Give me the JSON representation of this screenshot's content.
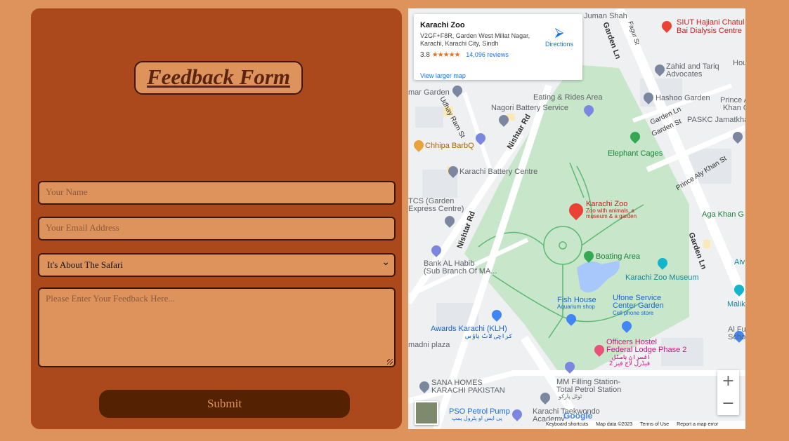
{
  "form": {
    "title": "Feedback Form",
    "name_placeholder": "Your Name",
    "email_placeholder": "Your Email Address",
    "topic_selected": "It's About The Safari",
    "feedback_placeholder": "Please Enter Your Feedback Here...",
    "submit_label": "Submit"
  },
  "map": {
    "info": {
      "place_name": "Karachi Zoo",
      "address": "V2GF+F8R, Garden West Millat Nagar, Karachi, Karachi City, Sindh",
      "rating": "3.8",
      "stars": "★★★★★",
      "reviews": "14,096 reviews",
      "directions": "Directions",
      "view_larger": "View larger map"
    },
    "labels": {
      "juman_shah": "Juman Shah",
      "siut": "SIUT Hajiani Chatul",
      "siut2": "Bai Dialysis Centre",
      "zahid": "Zahid and Tariq",
      "zahid2": "Advocates",
      "hashoo": "Hashoo Garden",
      "prince": "Prince A",
      "prince2": "Khan C",
      "pasckc": "PASKC Jamatkhan",
      "mar_garden": "mar Garden",
      "eating": "Eating & Rides Area",
      "nagori": "Nagori Battery Service",
      "chhipa": "Chhipa BarbQ",
      "elephant": "Elephant Cages",
      "kbc": "Karachi Battery Centre",
      "tcs": "TCS (Garden",
      "tcs2": "Express Centre)",
      "zoo_name": "Karachi Zoo",
      "zoo_desc1": "Zoo with animals, a",
      "zoo_desc2": "museum & a garden",
      "aga_khan": "Aga Khan G",
      "boating": "Boating Area",
      "museum": "Karachi Zoo Museum",
      "bank": "Bank AL Habib",
      "bank2": "(Sub Branch Of MA...",
      "fish": "Fish House",
      "fish2": "Aquarium shop",
      "ufone": "Ufone Service",
      "ufone2": "Center Garden",
      "ufone3": "Cell phone store",
      "awards": "Awards Karachi (KLH)",
      "awards_ur": "کراچی لاٹ ہاؤس",
      "madni": "madni plaza",
      "officers": "Officers Hostel",
      "officers2": "Federal Lodge Phase 2",
      "officers_ur": "افسران ہاسٹل",
      "officers_ur2": "فیڈرل لاج فیز 2",
      "sana": "SANA HOMES",
      "sana2": "KARACHI PAKISTAN",
      "mm": "MM Filling Station-",
      "mm2": "Total Petrol Station",
      "mm_ur": "ٹوٹل پارکو",
      "pso": "PSO Petrol Pump",
      "pso_ur": "پی ایس او پٹرول پمپ",
      "taekwondo": "Karachi Taekwondo",
      "taekwondo2": "Academy",
      "alfu": "Al Fu",
      "alfu2": "Scho",
      "malik": "Malik",
      "aiv": "Aiv",
      "udhay": "Udhay Ram St",
      "garden_st": "Garden St",
      "garden_ln_top": "Garden Ln",
      "garden_ln_mid": "Garden Ln",
      "garden_ln_right": "Garden Ln",
      "prince_aly": "Prince Aly Khan St",
      "nishtar1": "Nishtar Rd",
      "nishtar2": "Nishtar Rd",
      "fagur": "Fagur St",
      "hou": "Hou"
    },
    "footer": {
      "shortcuts": "Keyboard shortcuts",
      "mapdata": "Map data ©2023",
      "terms": "Terms of Use",
      "report": "Report a map error"
    },
    "google": "Google",
    "zoom_in": "+",
    "zoom_out": "−"
  },
  "colors": {
    "page_bg": "#de935c",
    "panel_bg": "#ab491c",
    "submit_bg": "#552103",
    "park_green": "#c8e6c9"
  }
}
